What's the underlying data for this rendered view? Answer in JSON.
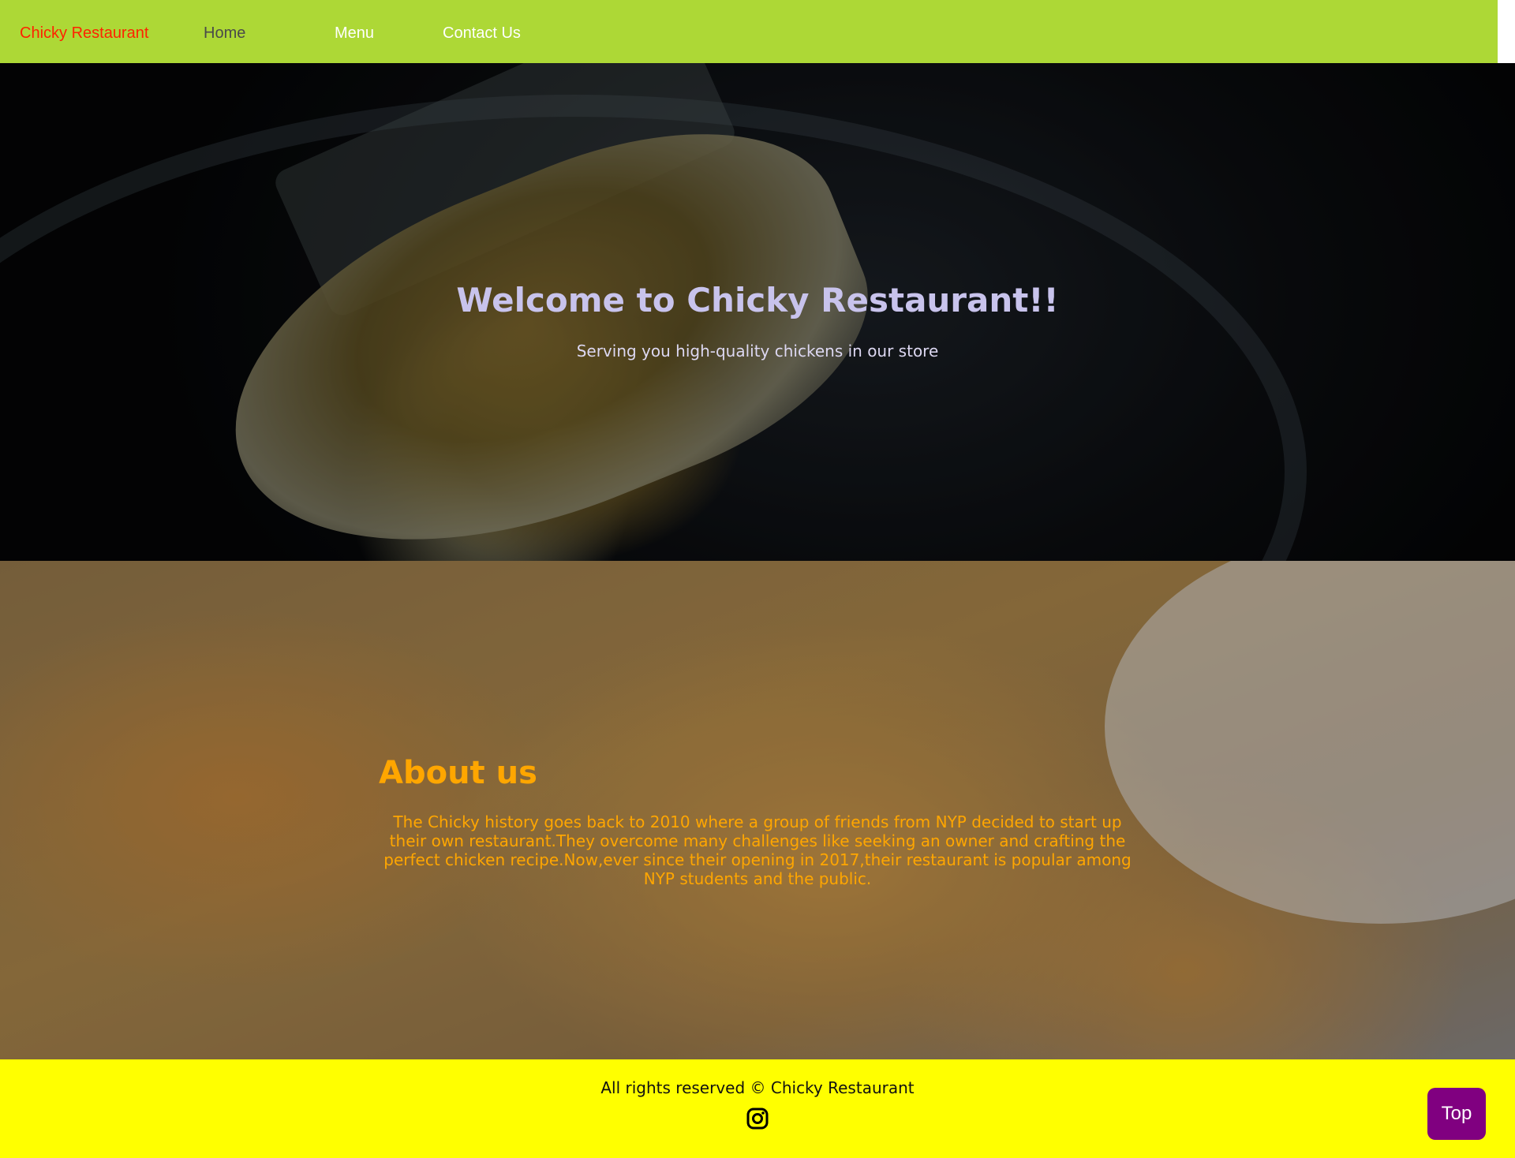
{
  "navbar": {
    "brand": "Chicky Restaurant",
    "links": [
      {
        "label": "Home"
      },
      {
        "label": "Menu"
      },
      {
        "label": "Contact Us"
      }
    ]
  },
  "hero": {
    "title": "Welcome to Chicky Restaurant!!",
    "subtitle": "Serving you high-quality chickens in our store"
  },
  "about": {
    "title": "About us",
    "text": "The Chicky history goes back to 2010 where a group of friends from NYP decided to start up their own restaurant.They overcome many challenges like seeking an owner and crafting the perfect chicken recipe.Now,ever since their opening in 2017,their restaurant is popular among NYP students and the public."
  },
  "footer": {
    "text": "All rights reserved © Chicky Restaurant",
    "icon": "instagram-icon"
  },
  "top_button": {
    "label": "Top"
  },
  "colors": {
    "navbar_bg": "#add836",
    "brand": "#ff2200",
    "hero_title": "#c8c3ec",
    "about_text": "#ffa600",
    "footer_bg": "#ffff00",
    "top_button_bg": "#800080"
  }
}
